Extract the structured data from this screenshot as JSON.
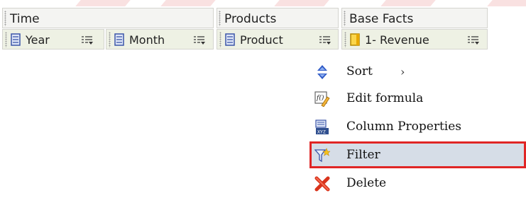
{
  "groups": [
    {
      "title": "Time"
    },
    {
      "title": "Products"
    },
    {
      "title": "Base Facts"
    }
  ],
  "columns": [
    {
      "label": "Year",
      "icon": "attribute-column-icon"
    },
    {
      "label": "Month",
      "icon": "attribute-column-icon"
    },
    {
      "label": "Product",
      "icon": "attribute-column-icon"
    },
    {
      "label": "1- Revenue",
      "icon": "measure-column-icon"
    }
  ],
  "context_menu": {
    "items": [
      {
        "label": "Sort",
        "icon": "sort-icon",
        "submenu": "›"
      },
      {
        "label": "Edit formula",
        "icon": "edit-formula-icon"
      },
      {
        "label": "Column Properties",
        "icon": "column-properties-icon"
      },
      {
        "label": "Filter",
        "icon": "filter-icon",
        "highlighted": true
      },
      {
        "label": "Delete",
        "icon": "delete-icon"
      }
    ]
  },
  "colors": {
    "highlight_outline": "#e02525",
    "highlight_bg": "#d6dde7",
    "header_bg": "#f4f4f2",
    "column_bg": "#eef1e4"
  }
}
